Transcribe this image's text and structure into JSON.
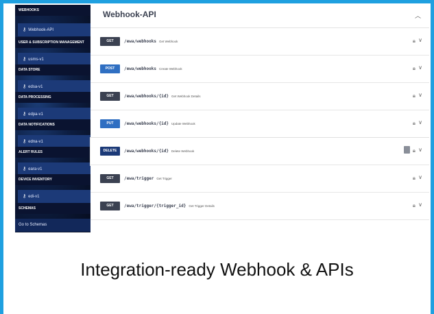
{
  "sidebar": {
    "sections": [
      {
        "title": "WEBHOOKS",
        "item": "Webhook-API"
      },
      {
        "title": "USER & SUBSCRIPTION MANAGEMENT",
        "item": "usms-v1"
      },
      {
        "title": "DATA STORE",
        "item": "edsa-v1"
      },
      {
        "title": "DATA PROCESSING",
        "item": "edpa-v1"
      },
      {
        "title": "DATA NOTIFICATIONS",
        "item": "edna-v1"
      },
      {
        "title": "ALERT RULES",
        "item": "eara-v1"
      },
      {
        "title": "DEVICE INVENTORY",
        "item": "edi-v1"
      }
    ],
    "schemas_label": "SCHEMAS",
    "goto_schemas": "Go to Schemas"
  },
  "main": {
    "title": "Webhook-API",
    "operations": [
      {
        "method": "GET",
        "path": "/ewa/webhooks",
        "summary": "Get Webhook"
      },
      {
        "method": "POST",
        "path": "/ewa/webhooks",
        "summary": "Create Webhook"
      },
      {
        "method": "GET",
        "path": "/ewa/webhooks/{id}",
        "summary": "Get Webhook Details"
      },
      {
        "method": "PUT",
        "path": "/ewa/webhooks/{id}",
        "summary": "Update Webhook"
      },
      {
        "method": "DELETE",
        "path": "/ewa/webhooks/{id}",
        "summary": "Delete Webhook"
      },
      {
        "method": "GET",
        "path": "/ewa/trigger",
        "summary": "Get Trigger"
      },
      {
        "method": "GET",
        "path": "/ewa/trigger/{trigger_id}",
        "summary": "Get Trigger Details"
      }
    ]
  },
  "caption": "Integration-ready Webhook & APIs",
  "colors": {
    "accent_border": "#1fa0e0",
    "get": "#3b4151",
    "post_put": "#2f6fc2",
    "delete": "#1c3a78"
  }
}
